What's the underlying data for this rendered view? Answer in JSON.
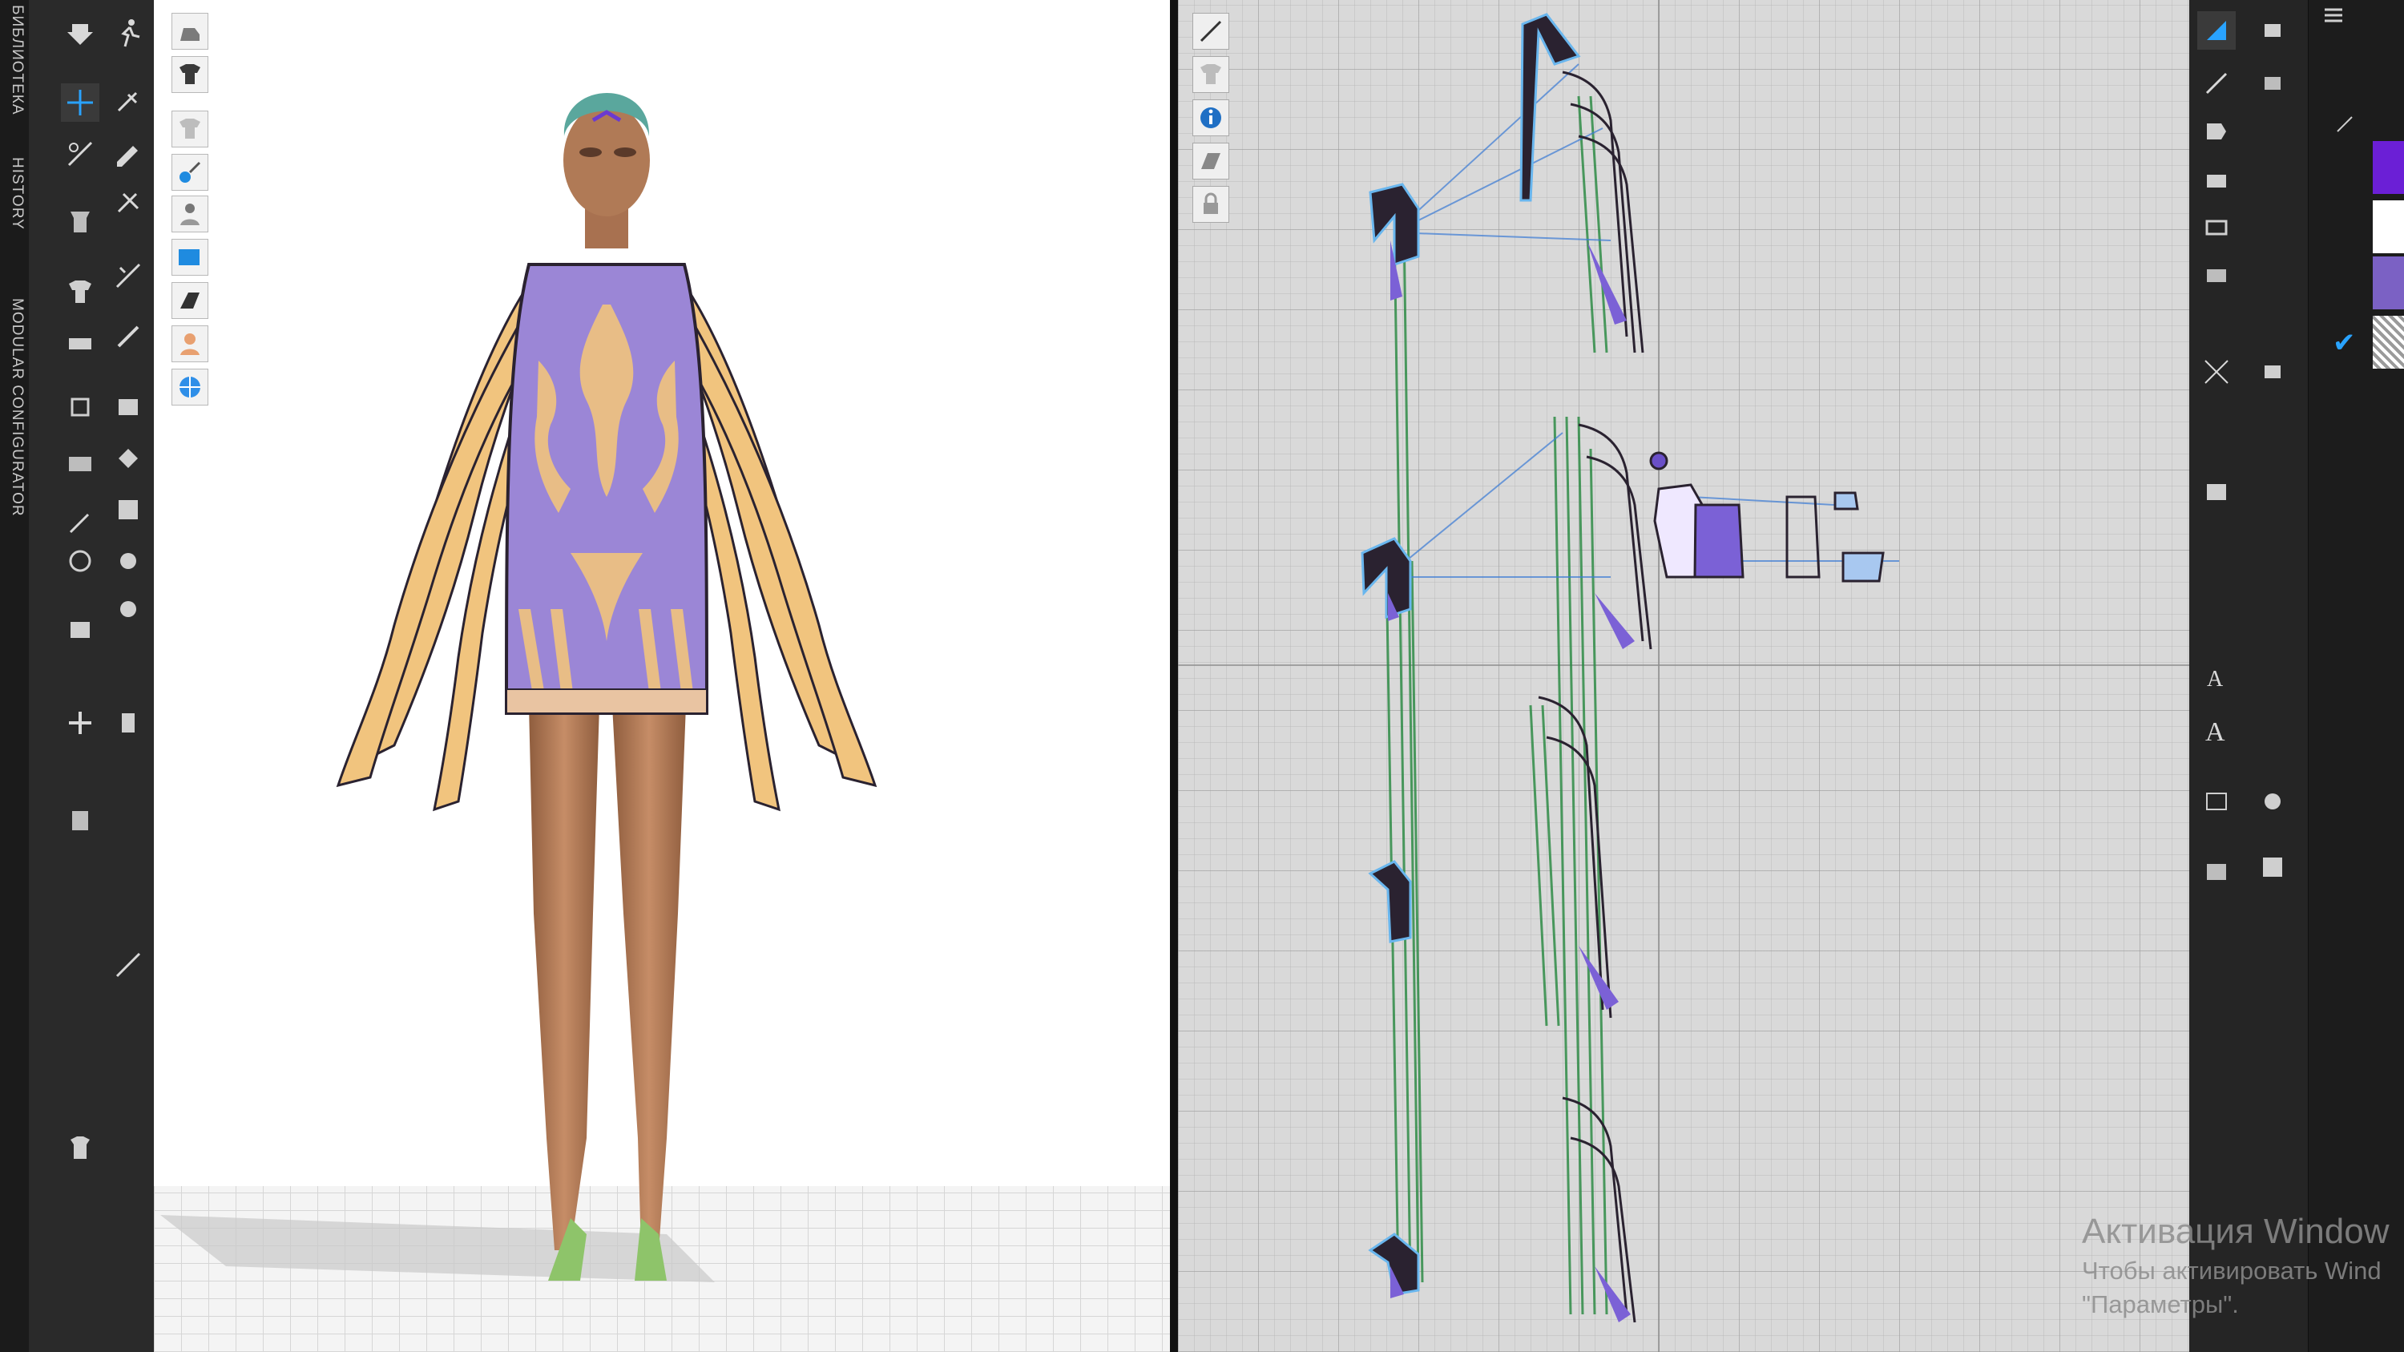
{
  "side_tabs": [
    "БИБЛИОТЕКА",
    "HISTORY",
    "MODULAR CONFIGURATOR"
  ],
  "left_toolbar": {
    "icons": [
      "move-arrow-icon",
      "walk-pose-icon",
      "transform-icon",
      "pin-icon",
      "select-garment-icon",
      "edit-pattern-icon",
      "fold-icon",
      "tack-icon",
      "shirt-icon",
      "arrange-icon",
      "sewing-icon",
      "brush-icon",
      "avatar-measure-icon",
      "button-icon",
      "zipper-icon",
      "texture-icon",
      "fabric-icon",
      "trim-icon",
      "puckering-icon",
      "pleat-icon",
      "shrink-icon",
      "strengthen-icon",
      "lasso-icon",
      "measure-icon",
      "ruler-icon",
      "avatar-icon",
      "skin-icon"
    ]
  },
  "viewport_3d": {
    "toolbar_icons": [
      "bodyform-icon",
      "garment-icon",
      "shirt-view-icon",
      "thickness-icon",
      "avatar-toggle-icon",
      "texture-view-icon",
      "mesh-view-icon",
      "skin-view-icon",
      "environment-icon"
    ],
    "colors": {
      "dress_purple": "#9b86d6",
      "fringe": "#f1c47e",
      "pattern_dark": "#2a2230",
      "skin": "#b8805c",
      "floor": "#f4f4f4"
    }
  },
  "viewport_2d": {
    "toolbar_icons": [
      "pen-tool-icon",
      "shirt-outline-icon",
      "info-icon",
      "layers-icon",
      "lock-icon"
    ],
    "colors": {
      "seam_green": "#2f8c47",
      "pattern_fill": "#7b61d6",
      "outline_glow": "#69b6ee"
    }
  },
  "right_toolbar": {
    "icons": [
      "select-point-icon",
      "edit-curve-icon",
      "transform-pattern-icon",
      "internal-line-icon",
      "rectangle-icon",
      "polygon-icon",
      "circle-icon",
      "dart-icon",
      "segment-sew-icon",
      "free-sew-icon",
      "check-length-icon",
      "text-icon",
      "annotation-icon",
      "grain-icon",
      "scissors-icon",
      "fold-arrangement-icon",
      "grading-icon"
    ]
  },
  "right_panel": {
    "swatch_colors": [
      "#6b1fd6",
      "#ffffff",
      "#7b61c4",
      "#cccccc"
    ],
    "checked_index": 3
  },
  "watermark": {
    "title": "Активация Window",
    "line1": "Чтобы активировать Wind",
    "line2": "\"Параметры\"."
  }
}
